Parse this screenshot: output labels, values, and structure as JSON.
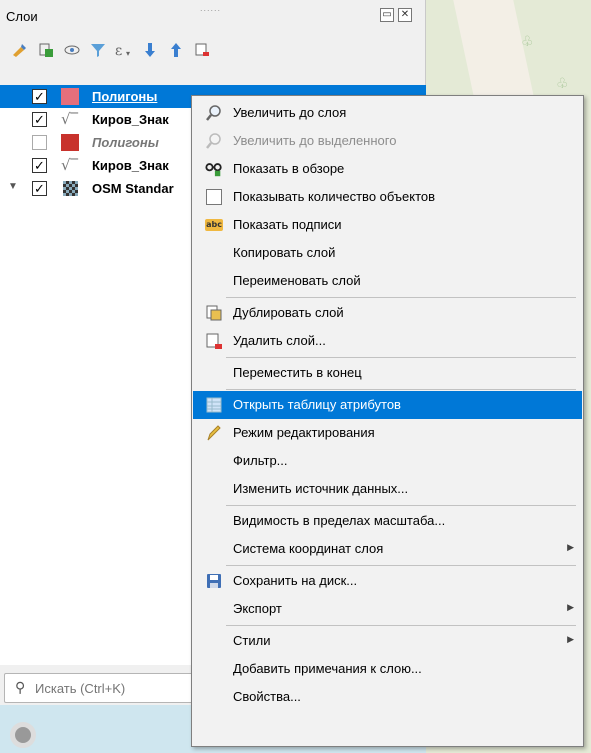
{
  "panel": {
    "title": "Слои",
    "grip": "......",
    "float_btn": "▭",
    "close_btn": "✕"
  },
  "toolbar": {
    "icons": [
      "style-icon",
      "add-group-icon",
      "visibility-icon",
      "filter-icon",
      "expression-filter-icon",
      "expand-all-icon",
      "collapse-all-icon",
      "remove-layer-icon"
    ]
  },
  "layers": [
    {
      "name": "Полигоны",
      "checked": true,
      "selected": true,
      "style": "polygon",
      "color": "#e56f7c"
    },
    {
      "name": "Киров_Знак",
      "checked": true,
      "selected": false,
      "style": "line"
    },
    {
      "name": "Полигоны",
      "checked": false,
      "selected": false,
      "style": "polygon",
      "color": "#c8322c"
    },
    {
      "name": "Киров_Знак",
      "checked": true,
      "selected": false,
      "style": "line"
    },
    {
      "name": "OSM Standar",
      "checked": true,
      "selected": false,
      "style": "raster"
    }
  ],
  "search": {
    "placeholder": "Искать (Ctrl+K)"
  },
  "context_menu": {
    "items": [
      {
        "label": "Увеличить до слоя",
        "icon": "zoom-to-layer-icon"
      },
      {
        "label": "Увеличить до выделенного",
        "icon": "zoom-to-selection-icon",
        "disabled": true
      },
      {
        "label": "Показать в обзоре",
        "icon": "overview-icon"
      },
      {
        "label": "Показывать количество объектов",
        "icon": "checkbox-icon"
      },
      {
        "label": "Показать подписи",
        "icon": "labels-icon"
      },
      {
        "label": "Копировать слой",
        "icon": ""
      },
      {
        "label": "Переименовать слой",
        "icon": ""
      },
      {
        "label": "Дублировать слой",
        "icon": "duplicate-layer-icon"
      },
      {
        "label": "Удалить слой...",
        "icon": "remove-layer-icon"
      },
      {
        "label": "Переместить в конец",
        "icon": ""
      },
      {
        "label": "Открыть таблицу атрибутов",
        "icon": "attribute-table-icon",
        "highlighted": true
      },
      {
        "label": "Режим редактирования",
        "icon": "edit-pencil-icon"
      },
      {
        "label": "Фильтр...",
        "icon": ""
      },
      {
        "label": "Изменить источник данных...",
        "icon": ""
      },
      {
        "label": "Видимость в пределах масштаба...",
        "icon": ""
      },
      {
        "label": "Система координат слоя",
        "icon": "",
        "submenu": true
      },
      {
        "label": "Сохранить на диск...",
        "icon": "save-icon"
      },
      {
        "label": "Экспорт",
        "icon": "",
        "submenu": true
      },
      {
        "label": "Стили",
        "icon": "",
        "submenu": true
      },
      {
        "label": "Добавить примечания к слою...",
        "icon": ""
      },
      {
        "label": "Свойства...",
        "icon": ""
      }
    ]
  },
  "colors": {
    "selection": "#0078d7",
    "menu_bg": "#f2f2f2"
  }
}
